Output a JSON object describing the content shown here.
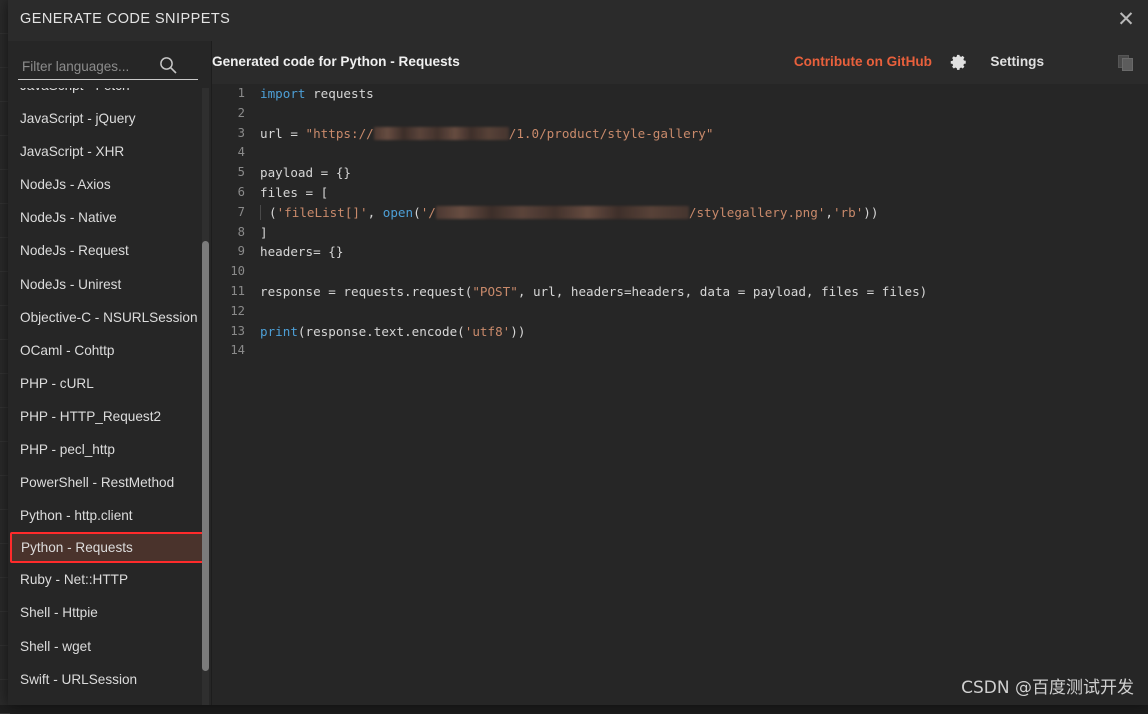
{
  "window": {
    "title": "GENERATE CODE SNIPPETS",
    "close_label": "✕"
  },
  "sidebar": {
    "search": {
      "placeholder": "Filter languages...",
      "value": "",
      "icon": "search-icon"
    },
    "selected": "Python - Requests",
    "items": [
      {
        "label": "JavaScript - Fetch",
        "selected": false
      },
      {
        "label": "JavaScript - jQuery",
        "selected": false
      },
      {
        "label": "JavaScript - XHR",
        "selected": false
      },
      {
        "label": "NodeJs - Axios",
        "selected": false
      },
      {
        "label": "NodeJs - Native",
        "selected": false
      },
      {
        "label": "NodeJs - Request",
        "selected": false
      },
      {
        "label": "NodeJs - Unirest",
        "selected": false
      },
      {
        "label": "Objective-C - NSURLSession",
        "selected": false
      },
      {
        "label": "OCaml - Cohttp",
        "selected": false
      },
      {
        "label": "PHP - cURL",
        "selected": false
      },
      {
        "label": "PHP - HTTP_Request2",
        "selected": false
      },
      {
        "label": "PHP - pecl_http",
        "selected": false
      },
      {
        "label": "PowerShell - RestMethod",
        "selected": false
      },
      {
        "label": "Python - http.client",
        "selected": false
      },
      {
        "label": "Python - Requests",
        "selected": true
      },
      {
        "label": "Ruby - Net::HTTP",
        "selected": false
      },
      {
        "label": "Shell - Httpie",
        "selected": false
      },
      {
        "label": "Shell - wget",
        "selected": false
      },
      {
        "label": "Swift - URLSession",
        "selected": false
      }
    ]
  },
  "code_header": {
    "title": "Generated code for Python - Requests",
    "github_link": "Contribute on GitHub",
    "settings_label": "Settings",
    "gear_icon": "gear-icon",
    "copy_icon": "copy-icon"
  },
  "code": {
    "language": "python",
    "line_count": 14,
    "lines": [
      {
        "n": 1,
        "text": "import requests"
      },
      {
        "n": 2,
        "text": ""
      },
      {
        "n": 3,
        "text": "url = \"https://[REDACTED]/1.0/product/style-gallery\""
      },
      {
        "n": 4,
        "text": ""
      },
      {
        "n": 5,
        "text": "payload = {}"
      },
      {
        "n": 6,
        "text": "files = ["
      },
      {
        "n": 7,
        "text": "  ('fileList[]', open('/[REDACTED]/stylegallery.png','rb'))"
      },
      {
        "n": 8,
        "text": "]"
      },
      {
        "n": 9,
        "text": "headers= {}"
      },
      {
        "n": 10,
        "text": ""
      },
      {
        "n": 11,
        "text": "response = requests.request(\"POST\", url, headers=headers, data = payload, files = files)"
      },
      {
        "n": 12,
        "text": ""
      },
      {
        "n": 13,
        "text": "print(response.text.encode('utf8'))"
      },
      {
        "n": 14,
        "text": ""
      }
    ]
  },
  "watermark": {
    "text": "CSDN @百度测试开发"
  },
  "colors": {
    "accent_orange": "#e8603c",
    "selection_border": "#ff2b2b",
    "selection_fill": "#4a332c",
    "code_bg": "#262626",
    "panel_bg": "#2b2b2b",
    "string": "#c98a6b",
    "keyword": "#4d9fd6"
  }
}
